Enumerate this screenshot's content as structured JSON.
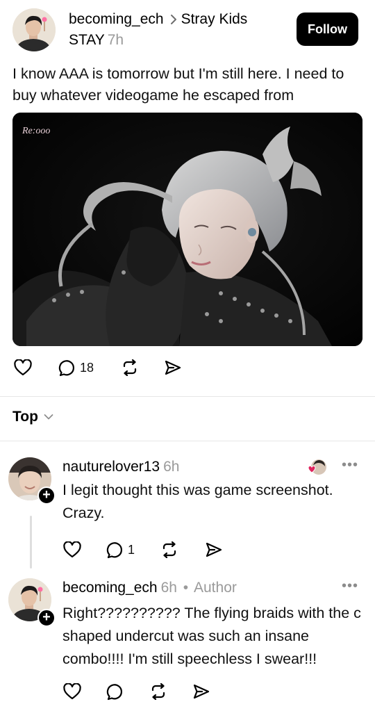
{
  "post": {
    "username": "becoming_ech",
    "community": "Stray Kids",
    "community_line2": "STAY",
    "time": "7h",
    "follow_label": "Follow",
    "text": "I know AAA is tomorrow but I'm still here. I need to buy whatever videogame he escaped from",
    "image_watermark": "Re:ooo",
    "icons": {
      "like": "heart-icon",
      "reply": "comment-icon",
      "repost": "repost-icon",
      "share": "send-icon"
    },
    "reply_count": "18"
  },
  "sort": {
    "label": "Top"
  },
  "comments": [
    {
      "username": "nauturelover13",
      "time": "6h",
      "text": "I legit thought this was game screenshot. Crazy.",
      "reply_count": "1",
      "more": "•••"
    },
    {
      "username": "becoming_ech",
      "time": "6h",
      "author_sep": "•",
      "author_label": "Author",
      "text": "Right?????????? The flying braids with the c shaped undercut was such an insane combo!!!! I'm still speechless I swear!!!",
      "more": "•••"
    }
  ],
  "colors": {
    "accent_black": "#000000",
    "meta_gray": "#9a9a9a",
    "liked_red": "#e0245e"
  }
}
